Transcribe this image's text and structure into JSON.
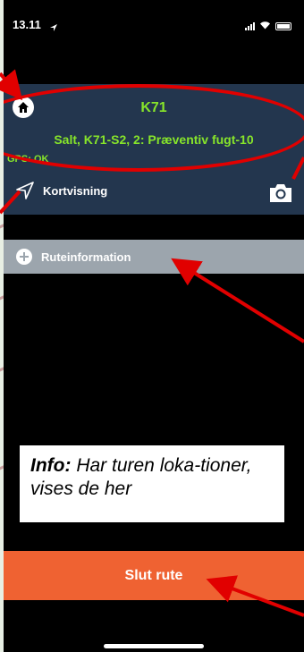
{
  "status_bar": {
    "time": "13.11"
  },
  "header": {
    "route_name": "K71",
    "route_subtitle": "Salt, K71-S2, 2: Præventiv fugt-10",
    "gps_status": "GPS: OK",
    "map_view_label": "Kortvisning"
  },
  "route_info": {
    "label": "Ruteinformation"
  },
  "info_note": {
    "bold": "Info:",
    "text": " Har turen loka-tioner, vises de her"
  },
  "actions": {
    "finish_label": "Slut rute"
  },
  "colors": {
    "header_bg": "#23364e",
    "accent_green": "#87e52a",
    "finish_orange": "#ef6232",
    "annotation_red": "#e10000",
    "info_bar_gray": "#9ca5ad"
  },
  "icons": [
    "home-icon",
    "navigation-arrow-icon",
    "camera-icon",
    "plus-circle-icon",
    "signal-icon",
    "wifi-icon",
    "battery-icon",
    "location-arrow-icon"
  ]
}
